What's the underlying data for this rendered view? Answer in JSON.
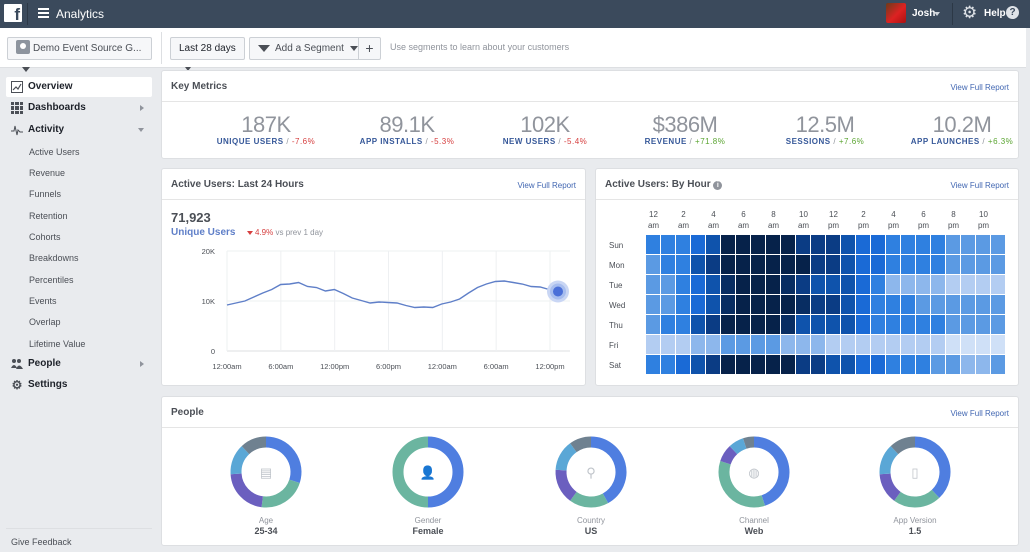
{
  "topbar": {
    "app_title": "Analytics",
    "user_name": "Josh",
    "help_label": "Help"
  },
  "toolbar": {
    "event_source": "Demo Event Source G...",
    "date_range": "Last 28 days",
    "segment_label": "Add a Segment",
    "add_label": "+",
    "hint": "Use segments to learn about your customers"
  },
  "sidebar": {
    "items": [
      {
        "label": "Overview",
        "icon": "chart-icon"
      },
      {
        "label": "Dashboards",
        "icon": "grid-icon"
      },
      {
        "label": "Activity",
        "icon": "pulse-icon"
      },
      {
        "label": "People",
        "icon": "people-icon"
      },
      {
        "label": "Settings",
        "icon": "gear-icon"
      }
    ],
    "activity_sub": [
      "Active Users",
      "Revenue",
      "Funnels",
      "Retention",
      "Cohorts",
      "Breakdowns",
      "Percentiles",
      "Events",
      "Overlap",
      "Lifetime Value"
    ],
    "feedback": "Give Feedback"
  },
  "key_metrics": {
    "title": "Key Metrics",
    "link": "View Full Report",
    "metrics": [
      {
        "value": "187K",
        "label": "UNIQUE USERS",
        "change": "-7.6%",
        "dir": "neg"
      },
      {
        "value": "89.1K",
        "label": "APP INSTALLS",
        "change": "-5.3%",
        "dir": "neg"
      },
      {
        "value": "102K",
        "label": "NEW USERS",
        "change": "-5.4%",
        "dir": "neg"
      },
      {
        "value": "$386M",
        "label": "REVENUE",
        "change": "+71.8%",
        "dir": "pos"
      },
      {
        "value": "12.5M",
        "label": "SESSIONS",
        "change": "+7.6%",
        "dir": "pos"
      },
      {
        "value": "10.2M",
        "label": "APP LAUNCHES",
        "change": "+6.3%",
        "dir": "pos"
      }
    ]
  },
  "active_24h": {
    "title": "Active Users: Last 24 Hours",
    "link": "View Full Report",
    "total": "71,923",
    "metric_name": "Unique Users",
    "delta_pct": "4.9%",
    "delta_text": "vs prev 1 day"
  },
  "by_hour": {
    "title": "Active Users: By Hour",
    "link": "View Full Report"
  },
  "people": {
    "title": "People",
    "link": "View Full Report",
    "donuts": [
      {
        "label": "Age",
        "value": "25-34",
        "icon": "cake-icon",
        "segments": [
          0.3,
          0.22,
          0.22,
          0.14,
          0.12
        ]
      },
      {
        "label": "Gender",
        "value": "Female",
        "icon": "person-icon",
        "segments": [
          0.5,
          0.5
        ]
      },
      {
        "label": "Country",
        "value": "US",
        "icon": "location-pin-icon",
        "segments": [
          0.42,
          0.18,
          0.16,
          0.14,
          0.1
        ]
      },
      {
        "label": "Channel",
        "value": "Web",
        "icon": "globe-icon",
        "segments": [
          0.45,
          0.35,
          0.08,
          0.07,
          0.05
        ]
      },
      {
        "label": "App Version",
        "value": "1.5",
        "icon": "mobile-icon",
        "segments": [
          0.38,
          0.22,
          0.14,
          0.14,
          0.12
        ]
      }
    ],
    "colors": [
      "#4f7ee0",
      "#6bb5a0",
      "#6b5fbf",
      "#5aa7d6",
      "#6f8190"
    ]
  },
  "chart_data": [
    {
      "type": "line",
      "title": "Active Users: Last 24 Hours",
      "ylabel": "",
      "xlabel": "",
      "ylim": [
        0,
        20000
      ],
      "yticks": [
        "0",
        "10K",
        "20K"
      ],
      "yticks_values": [
        0,
        10000,
        20000
      ],
      "xticks": [
        "12:00am",
        "6:00am",
        "12:00pm",
        "6:00pm",
        "12:00am",
        "6:00am",
        "12:00pm"
      ],
      "grid": true,
      "series": [
        {
          "name": "Unique Users",
          "color": "#5f7fc8",
          "values": [
            9200,
            9600,
            10000,
            10800,
            11600,
            12300,
            13300,
            13400,
            13700,
            12900,
            12700,
            12000,
            12300,
            11500,
            10600,
            10100,
            9600,
            9800,
            9700,
            9600,
            9100,
            8700,
            8800,
            8700,
            9400,
            9800,
            10400,
            11600,
            12700,
            13400,
            13900,
            14000,
            13700,
            13400,
            12900,
            12800,
            12300,
            11900
          ]
        }
      ]
    },
    {
      "type": "heatmap",
      "title": "Active Users: By Hour",
      "x": [
        "12 am",
        "1 am",
        "2 am",
        "3 am",
        "4 am",
        "5 am",
        "6 am",
        "7 am",
        "8 am",
        "9 am",
        "10 am",
        "11 am",
        "12 pm",
        "1 pm",
        "2 pm",
        "3 pm",
        "4 pm",
        "5 pm",
        "6 pm",
        "7 pm",
        "8 pm",
        "9 pm",
        "10 pm",
        "11 pm"
      ],
      "xtick_labels": [
        [
          "12",
          "am"
        ],
        [
          "2",
          "am"
        ],
        [
          "4",
          "am"
        ],
        [
          "6",
          "am"
        ],
        [
          "8",
          "am"
        ],
        [
          "10",
          "am"
        ],
        [
          "12",
          "pm"
        ],
        [
          "2",
          "pm"
        ],
        [
          "4",
          "pm"
        ],
        [
          "6",
          "pm"
        ],
        [
          "8",
          "pm"
        ],
        [
          "10",
          "pm"
        ]
      ],
      "y": [
        "Sun",
        "Mon",
        "Tue",
        "Wed",
        "Thu",
        "Fri",
        "Sat"
      ],
      "values": [
        [
          5,
          5,
          5,
          6,
          7,
          10,
          10,
          10,
          10,
          10,
          8,
          8,
          8,
          7,
          6,
          6,
          5,
          5,
          5,
          5,
          4,
          4,
          4,
          4
        ],
        [
          4,
          5,
          5,
          7,
          8,
          10,
          10,
          10,
          10,
          10,
          10,
          8,
          8,
          7,
          6,
          6,
          5,
          5,
          5,
          5,
          4,
          4,
          4,
          4
        ],
        [
          4,
          4,
          5,
          6,
          7,
          9,
          10,
          10,
          10,
          9,
          8,
          7,
          7,
          7,
          6,
          5,
          3,
          3,
          3,
          3,
          2,
          2,
          2,
          2
        ],
        [
          4,
          4,
          5,
          6,
          7,
          9,
          10,
          10,
          10,
          10,
          9,
          8,
          8,
          7,
          6,
          5,
          5,
          5,
          4,
          4,
          4,
          4,
          4,
          4
        ],
        [
          4,
          5,
          5,
          7,
          8,
          10,
          10,
          10,
          10,
          9,
          7,
          7,
          7,
          7,
          6,
          5,
          5,
          5,
          5,
          5,
          4,
          4,
          4,
          4
        ],
        [
          2,
          2,
          2,
          3,
          3,
          4,
          4,
          4,
          4,
          3,
          3,
          3,
          2,
          2,
          2,
          2,
          2,
          2,
          2,
          2,
          1,
          1,
          1,
          1
        ],
        [
          5,
          5,
          6,
          7,
          8,
          10,
          10,
          10,
          10,
          10,
          8,
          8,
          7,
          7,
          6,
          6,
          5,
          5,
          5,
          4,
          4,
          3,
          3,
          4
        ]
      ],
      "scale": "1 (light) to 10 (dark)"
    }
  ]
}
